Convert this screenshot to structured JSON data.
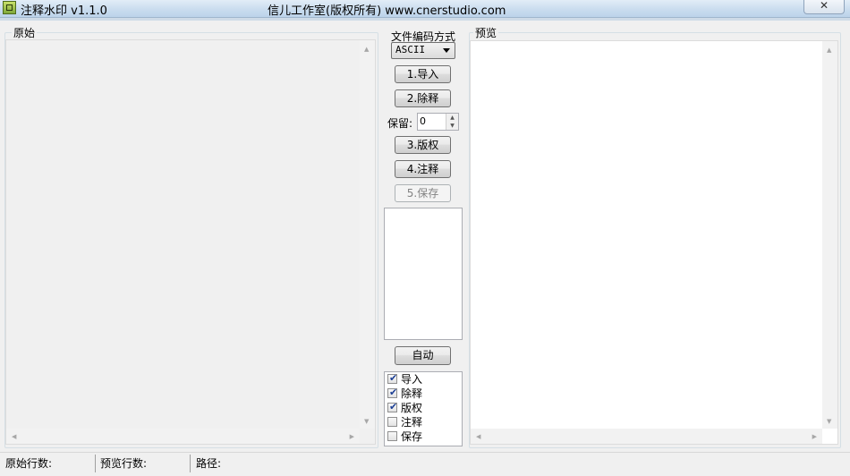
{
  "window": {
    "title": "注释水印 v1.1.0",
    "center_title": "信儿工作室(版权所有) www.cnerstudio.com",
    "close_glyph": "✕"
  },
  "original_panel": {
    "label": "原始"
  },
  "preview_panel": {
    "label": "预览"
  },
  "controls": {
    "encoding_label": "文件编码方式",
    "encoding_value": "ASCII",
    "import_button": "1.导入",
    "remove_comments_button": "2.除释",
    "keep_label": "保留:",
    "keep_value": "0",
    "copyright_button": "3.版权",
    "comment_button": "4.注释",
    "save_button": "5.保存",
    "auto_button": "自动"
  },
  "auto_steps": [
    {
      "label": "导入",
      "checked": true
    },
    {
      "label": "除释",
      "checked": true
    },
    {
      "label": "版权",
      "checked": true
    },
    {
      "label": "注释",
      "checked": false
    },
    {
      "label": "保存",
      "checked": false
    }
  ],
  "statusbar": {
    "original_lines": "原始行数:",
    "preview_lines": "预览行数:",
    "path": "路径:"
  },
  "icons": {
    "app": "app-icon",
    "close": "close-icon",
    "up": "scroll-up-arrow-icon",
    "down": "scroll-down-arrow-icon",
    "left": "scroll-left-arrow-icon",
    "right": "scroll-right-arrow-icon"
  }
}
